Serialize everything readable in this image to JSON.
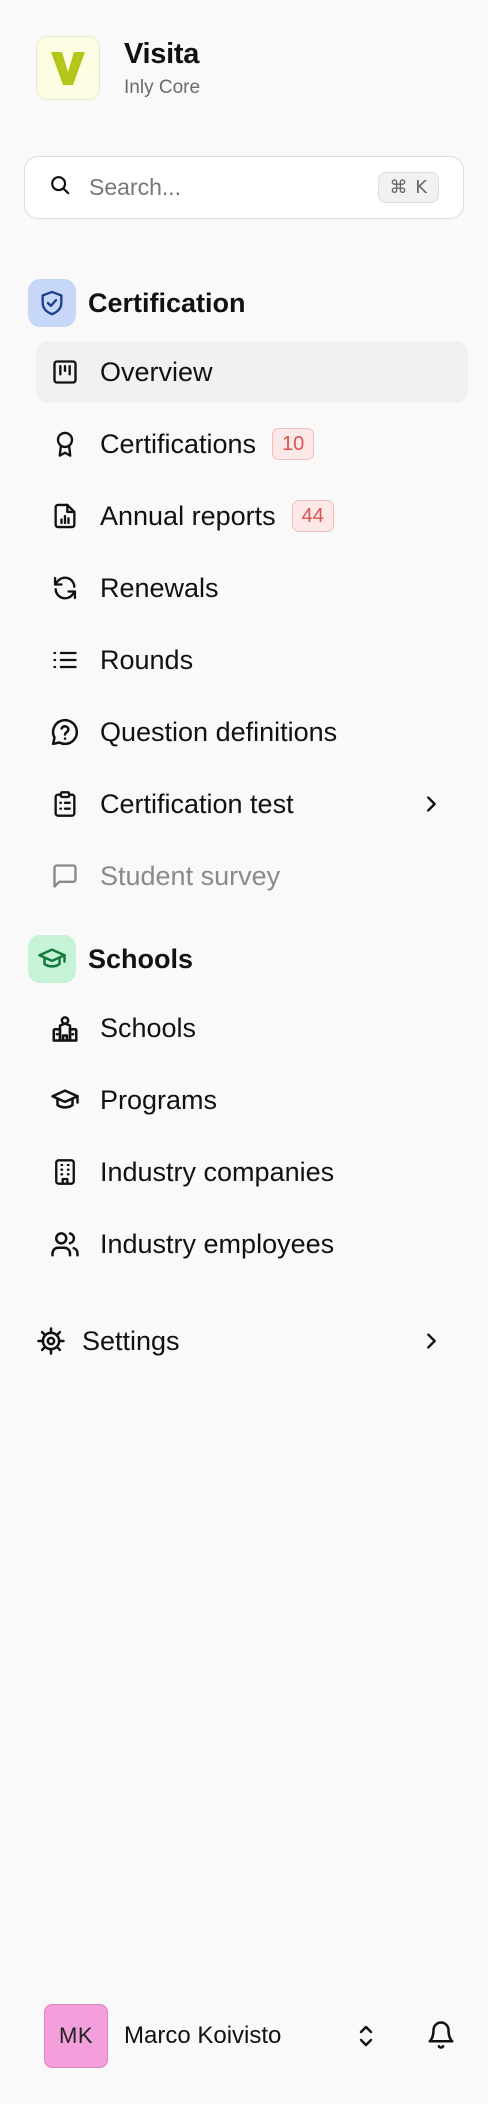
{
  "brand": {
    "logo_letter": "V",
    "name": "Visita",
    "subtitle": "Inly Core",
    "logo_color": "#b5c61a"
  },
  "search": {
    "placeholder": "Search...",
    "shortcut": "⌘ K"
  },
  "sections": [
    {
      "title": "Certification",
      "icon": "shield-check-icon",
      "icon_bg": "#c7d7f7",
      "items": [
        {
          "label": "Overview",
          "icon": "kanban-icon",
          "active": true
        },
        {
          "label": "Certifications",
          "icon": "award-icon",
          "badge": "10"
        },
        {
          "label": "Annual reports",
          "icon": "file-chart-icon",
          "badge": "44"
        },
        {
          "label": "Renewals",
          "icon": "refresh-icon"
        },
        {
          "label": "Rounds",
          "icon": "list-icon"
        },
        {
          "label": "Question definitions",
          "icon": "help-circle-icon"
        },
        {
          "label": "Certification test",
          "icon": "clipboard-icon",
          "has_submenu": true
        },
        {
          "label": "Student survey",
          "icon": "message-square-icon",
          "disabled": true
        }
      ]
    },
    {
      "title": "Schools",
      "icon": "graduation-cap-icon",
      "icon_bg": "#c6f2d6",
      "items": [
        {
          "label": "Schools",
          "icon": "school-icon"
        },
        {
          "label": "Programs",
          "icon": "graduation-cap-icon"
        },
        {
          "label": "Industry companies",
          "icon": "building-icon"
        },
        {
          "label": "Industry employees",
          "icon": "users-icon"
        }
      ]
    }
  ],
  "settings": {
    "label": "Settings",
    "icon": "gear-icon"
  },
  "user": {
    "initials": "MK",
    "name": "Marco Koivisto",
    "avatar_color": "#f29fdc"
  }
}
